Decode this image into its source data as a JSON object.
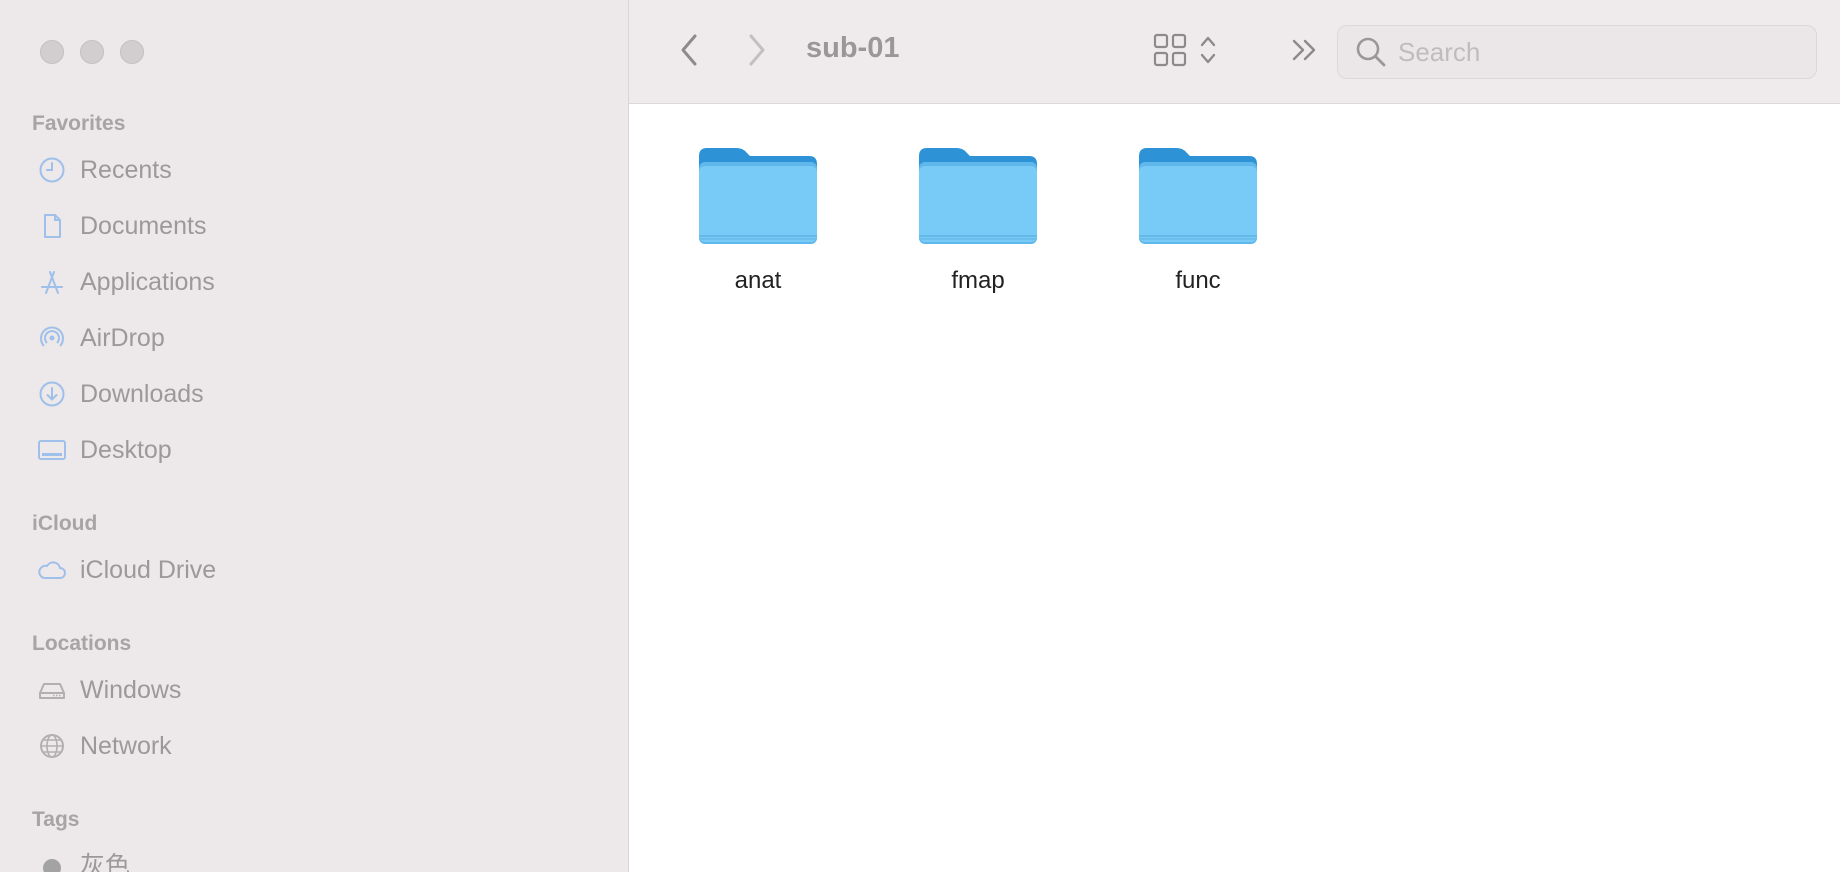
{
  "window": {
    "title": "sub-01"
  },
  "toolbar": {
    "search_placeholder": "Search"
  },
  "sidebar": {
    "favorites_title": "Favorites",
    "favorites": [
      {
        "label": "Recents",
        "icon": "clock-icon"
      },
      {
        "label": "Documents",
        "icon": "document-icon"
      },
      {
        "label": "Applications",
        "icon": "applications-icon"
      },
      {
        "label": "AirDrop",
        "icon": "airdrop-icon"
      },
      {
        "label": "Downloads",
        "icon": "download-icon"
      },
      {
        "label": "Desktop",
        "icon": "desktop-icon"
      }
    ],
    "icloud_title": "iCloud",
    "icloud": [
      {
        "label": "iCloud Drive",
        "icon": "cloud-icon"
      }
    ],
    "locations_title": "Locations",
    "locations": [
      {
        "label": "Windows",
        "icon": "drive-icon"
      },
      {
        "label": "Network",
        "icon": "globe-icon"
      }
    ],
    "tags_title": "Tags",
    "tags": [
      {
        "label": "灰色",
        "color": "#a3a3a3"
      }
    ]
  },
  "content": {
    "folders": [
      {
        "name": "anat"
      },
      {
        "name": "fmap"
      },
      {
        "name": "func"
      }
    ]
  },
  "colors": {
    "sidebar_bg": "#ede8e9",
    "icon_blue": "#8fb6e6",
    "folder_blue": "#74c9f5"
  }
}
